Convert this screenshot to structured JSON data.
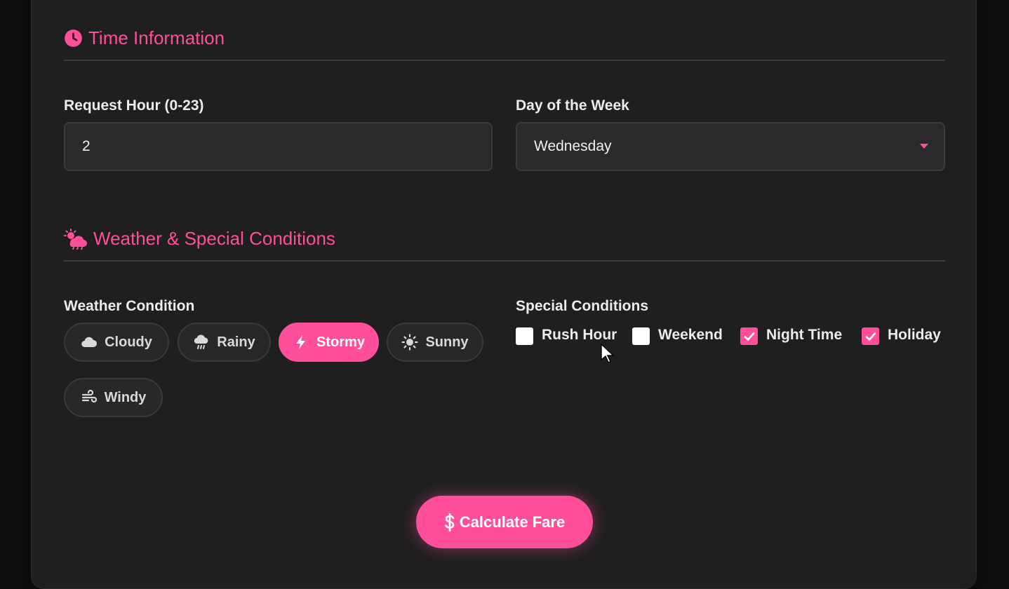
{
  "time_section": {
    "title": "Time Information",
    "hour_label": "Request Hour (0-23)",
    "hour_value": "2",
    "day_label": "Day of the Week",
    "day_value": "Wednesday"
  },
  "weather_section": {
    "title": "Weather & Special Conditions",
    "weather_label": "Weather Condition",
    "weather_options": [
      {
        "label": "Cloudy",
        "icon": "cloud-icon",
        "selected": false
      },
      {
        "label": "Rainy",
        "icon": "cloud-rain-icon",
        "selected": false
      },
      {
        "label": "Stormy",
        "icon": "bolt-icon",
        "selected": true
      },
      {
        "label": "Sunny",
        "icon": "sun-icon",
        "selected": false
      },
      {
        "label": "Windy",
        "icon": "wind-icon",
        "selected": false
      }
    ],
    "special_label": "Special Conditions",
    "special_options": [
      {
        "label": "Rush Hour",
        "checked": false
      },
      {
        "label": "Weekend",
        "checked": false
      },
      {
        "label": "Night Time",
        "checked": true
      },
      {
        "label": "Holiday",
        "checked": true
      }
    ]
  },
  "cta": {
    "icon": "dollar-icon",
    "label": "Calculate Fare"
  },
  "colors": {
    "accent": "#ff4f9a",
    "panel": "#1f1f20",
    "background": "#0e0e0e"
  }
}
